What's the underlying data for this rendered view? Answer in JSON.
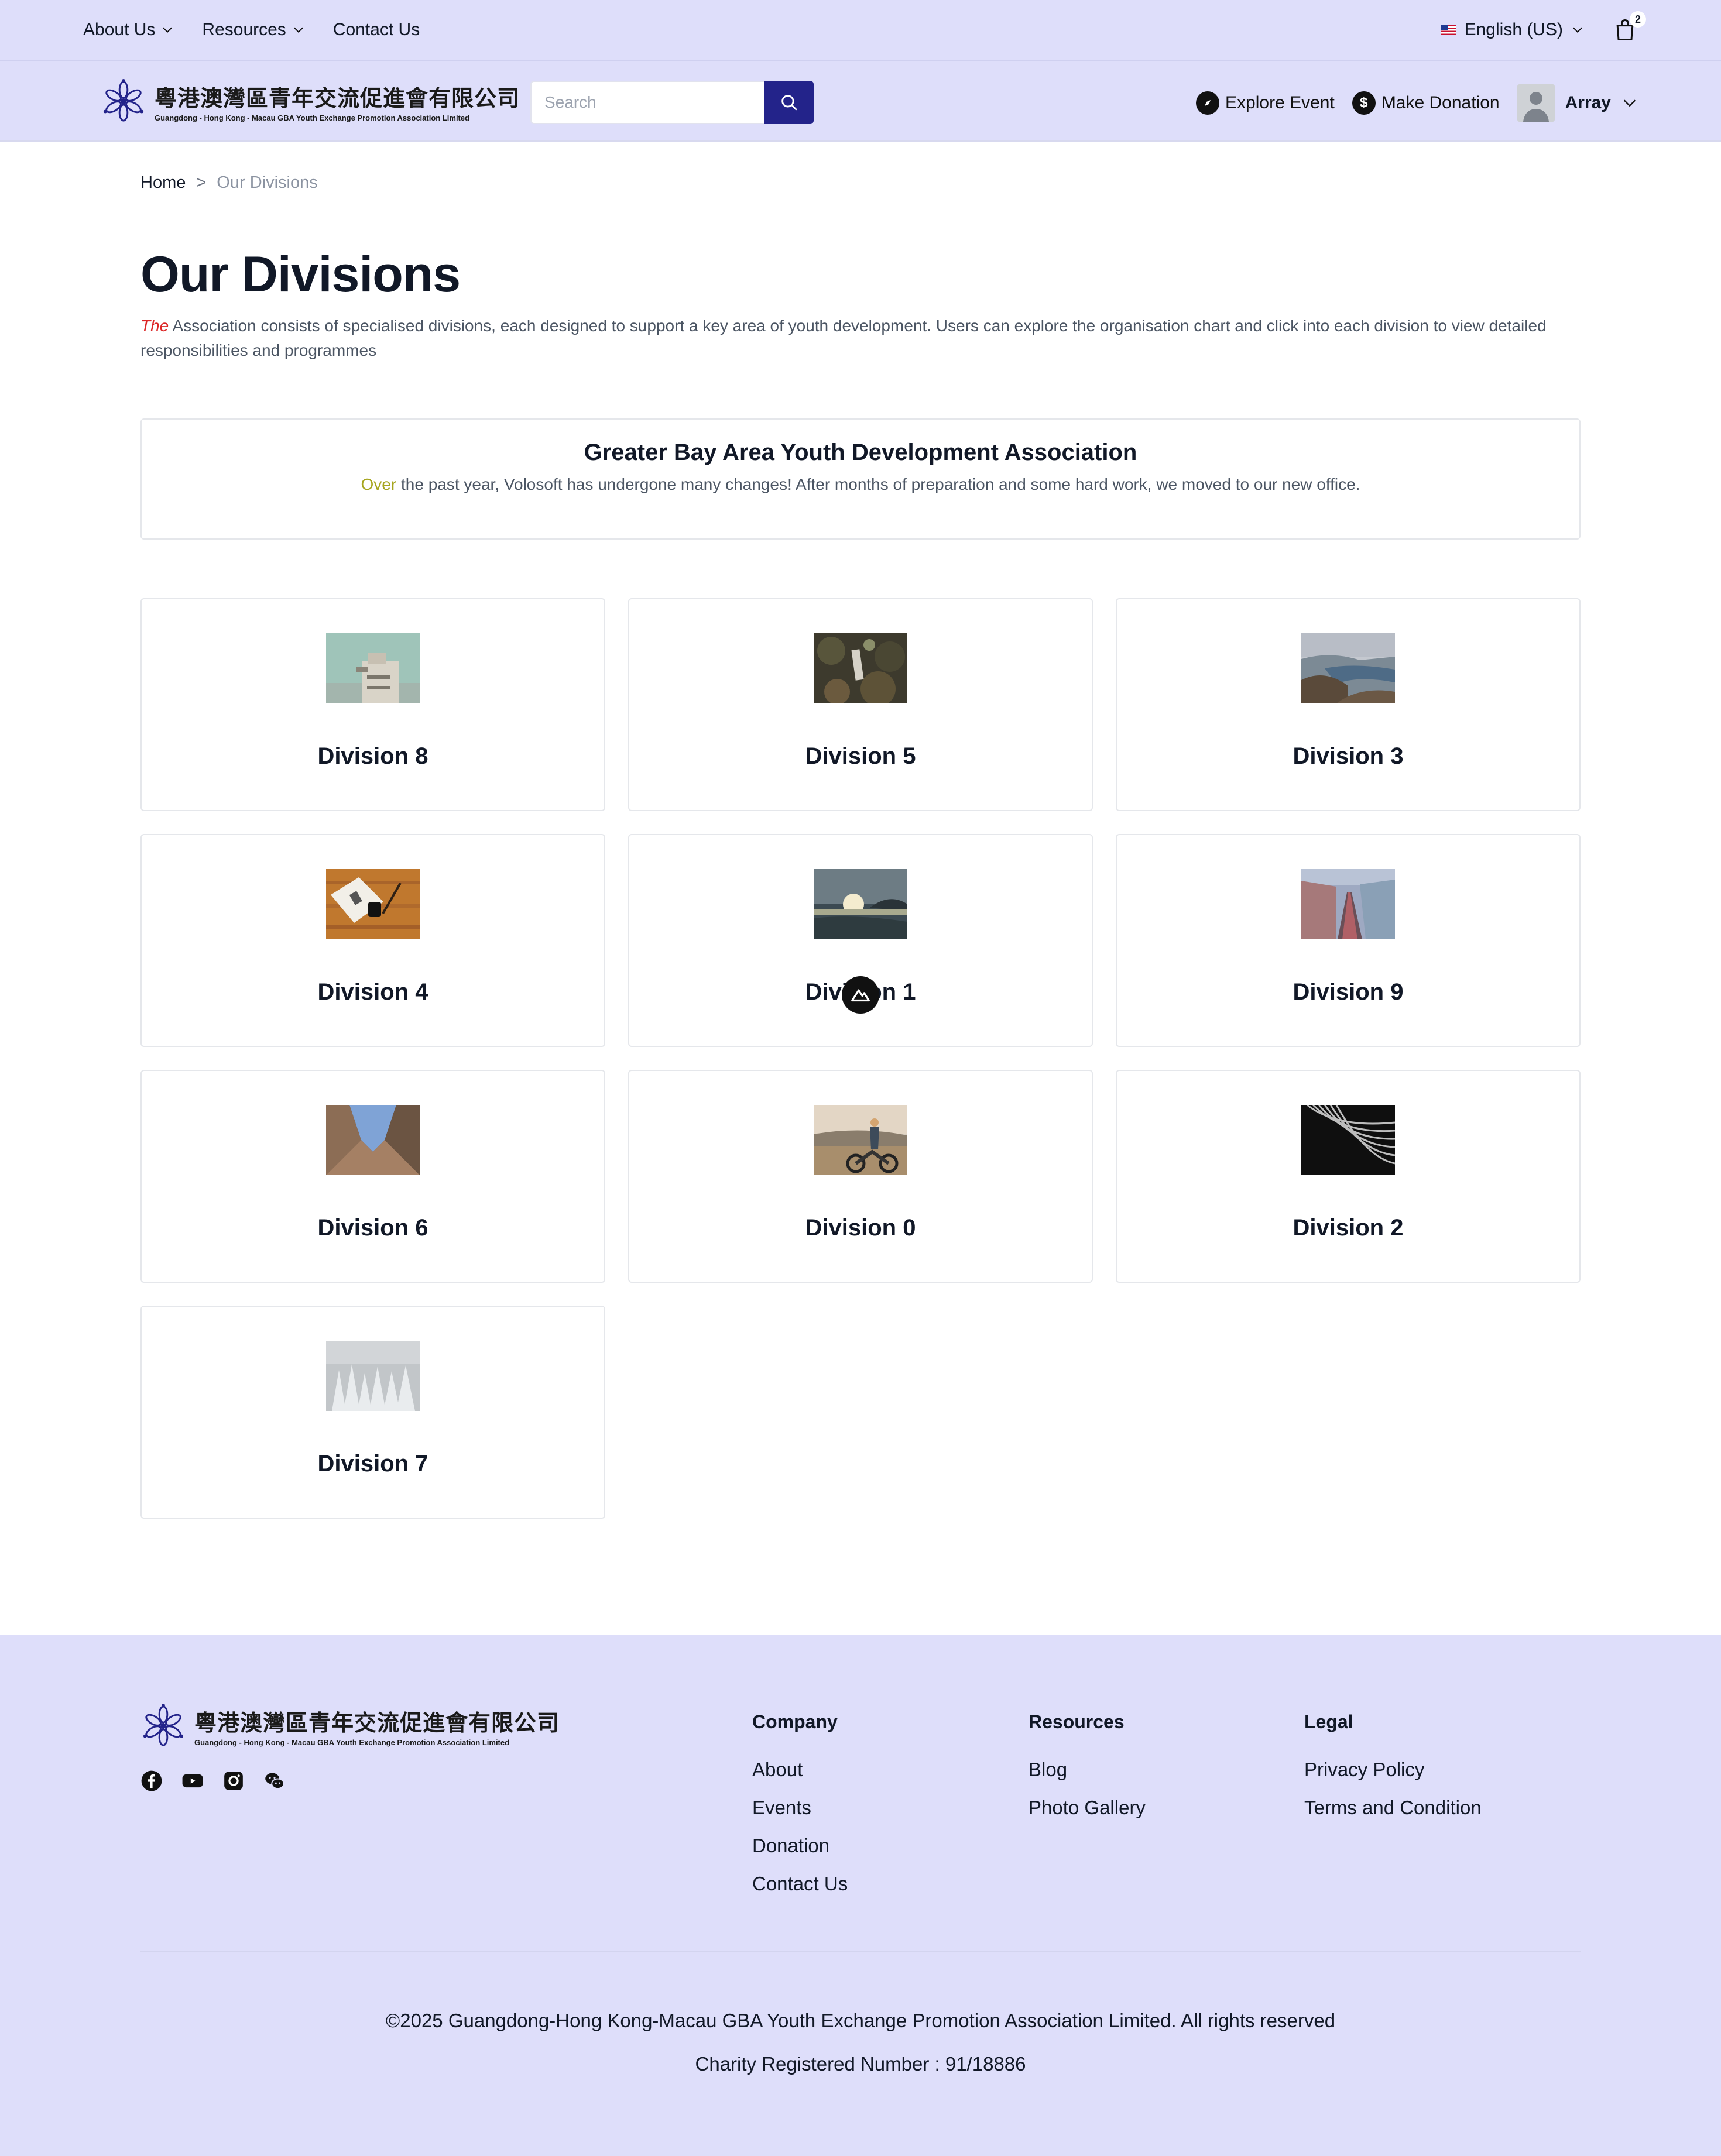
{
  "topnav": {
    "items": [
      {
        "label": "About Us",
        "has_dropdown": true
      },
      {
        "label": "Resources",
        "has_dropdown": true
      },
      {
        "label": "Contact Us",
        "has_dropdown": false
      }
    ],
    "language": "English (US)",
    "cart_count": "2"
  },
  "header": {
    "logo_cn": "粵港澳灣區青年交流促進會有限公司",
    "logo_en": "Guangdong - Hong Kong - Macau GBA Youth Exchange Promotion Association Limited",
    "search_placeholder": "Search",
    "explore_label": "Explore Event",
    "donation_label": "Make Donation",
    "donation_icon_glyph": "$",
    "user_name": "Array"
  },
  "breadcrumb": {
    "home": "Home",
    "separator": ">",
    "current": "Our Divisions"
  },
  "main": {
    "title": "Our Divisions",
    "intro_em": "The",
    "intro_rest": " Association consists of specialised divisions, each designed to support a key area of youth development. Users can explore the organisation chart and click into each division to view detailed responsibilities and programmes",
    "assoc_title": "Greater Bay Area Youth Development Association",
    "assoc_em": "Over",
    "assoc_rest": " the past year, Volosoft has undergone many changes! After months of preparation and some hard work, we moved to our new office."
  },
  "divisions": [
    {
      "name": "Division 8",
      "thumb": "building-sky"
    },
    {
      "name": "Division 5",
      "thumb": "forest-path"
    },
    {
      "name": "Division 3",
      "thumb": "mountain-lake"
    },
    {
      "name": "Division 4",
      "thumb": "book-on-wood"
    },
    {
      "name": "Division 1",
      "thumb": "sunset-sea"
    },
    {
      "name": "Division 9",
      "thumb": "railway-coast"
    },
    {
      "name": "Division 6",
      "thumb": "buildings-up"
    },
    {
      "name": "Division 0",
      "thumb": "motorbike-woman"
    },
    {
      "name": "Division 2",
      "thumb": "abstract-curves"
    },
    {
      "name": "Division 7",
      "thumb": "snowy-forest"
    }
  ],
  "footer": {
    "columns": [
      {
        "title": "Company",
        "links": [
          "About",
          "Events",
          "Donation",
          "Contact Us"
        ]
      },
      {
        "title": "Resources",
        "links": [
          "Blog",
          "Photo Gallery"
        ]
      },
      {
        "title": "Legal",
        "links": [
          "Privacy Policy",
          "Terms and Condition"
        ]
      }
    ],
    "socials": [
      "facebook-icon",
      "youtube-icon",
      "instagram-icon",
      "wechat-icon"
    ],
    "copyright": "©2025 Guangdong-Hong Kong-Macau GBA Youth Exchange Promotion Association Limited. All rights reserved",
    "charity": "Charity Registered Number : 91/18886"
  },
  "colors": {
    "header_bg": "#dedefa",
    "search_button": "#23238a",
    "intro_accent": "#dc2626",
    "assoc_accent": "#a6a51e"
  }
}
